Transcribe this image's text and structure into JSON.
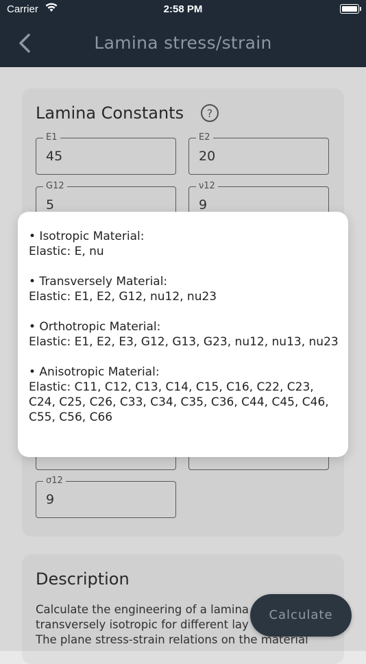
{
  "status": {
    "carrier": "Carrier",
    "time": "2:58 PM"
  },
  "nav": {
    "title": "Lamina stress/strain"
  },
  "constants": {
    "title": "Lamina Constants",
    "fields": [
      {
        "label": "E1",
        "value": "45"
      },
      {
        "label": "E2",
        "value": "20"
      },
      {
        "label": "G12",
        "value": "5"
      },
      {
        "label": "ν12",
        "value": "9"
      },
      {
        "label": "σ12",
        "value": "9"
      }
    ]
  },
  "description": {
    "title": "Description",
    "lines": [
      "Calculate the engineering of a lamina",
      "transversely isotropic for different lay",
      "The plane stress-strain relations on the material"
    ]
  },
  "calculate_label": "Calculate",
  "popup": {
    "sections": [
      {
        "heading": "• Isotropic Material:",
        "detail": "Elastic: E, nu"
      },
      {
        "heading": "• Transversely Material:",
        "detail": "Elastic: E1, E2, G12, nu12, nu23"
      },
      {
        "heading": "• Orthotropic Material:",
        "detail": "Elastic: E1, E2, E3, G12, G13, G23, nu12, nu13, nu23"
      },
      {
        "heading": "• Anisotropic Material:",
        "detail": "Elastic: C11, C12, C13, C14, C15, C16, C22, C23, C24, C25, C26, C33, C34, C35, C36, C44, C45, C46, C55, C56, C66"
      }
    ]
  }
}
